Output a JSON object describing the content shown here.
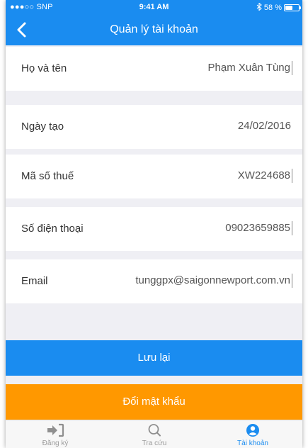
{
  "status_bar": {
    "carrier": "●●●○○ SNP",
    "time": "9:41 AM",
    "battery": "58 %",
    "battery_level": 0.58
  },
  "nav": {
    "title": "Quản lý tài khoản",
    "back_icon": "chevron-left-icon"
  },
  "fields": [
    {
      "label": "Họ và tên",
      "value": "Phạm Xuân Tùng"
    },
    {
      "label": "Ngày tạo",
      "value": "24/02/2016"
    },
    {
      "label": "Mã số thuế",
      "value": "XW224688"
    },
    {
      "label": "Số điện thoại",
      "value": "09023659885"
    },
    {
      "label": "Email",
      "value": "tunggpx@saigonnewport.com.vn"
    }
  ],
  "buttons": {
    "save": "Lưu lại",
    "change_password": "Đổi mật khẩu"
  },
  "tabs": [
    {
      "label": "Đăng ký",
      "icon": "sign-in-icon"
    },
    {
      "label": "Tra cứu",
      "icon": "search-icon"
    },
    {
      "label": "Tài khoản",
      "icon": "user-circle-icon",
      "active": true
    }
  ],
  "colors": {
    "primary": "#1a8cf0",
    "accent": "#ff9800",
    "background": "#efeff4"
  }
}
